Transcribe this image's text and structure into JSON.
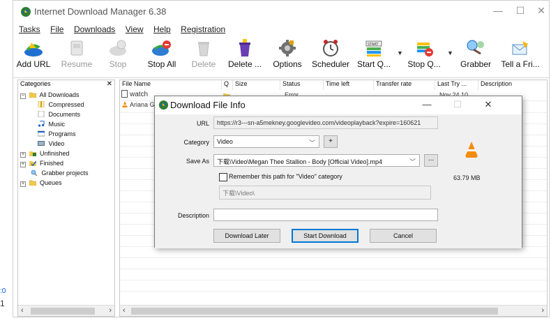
{
  "app": {
    "title": "Internet Download Manager 6.38",
    "window_controls": {
      "minimize": "—",
      "maximize": "☐",
      "close": "✕"
    }
  },
  "menu": {
    "items": [
      "Tasks",
      "File",
      "Downloads",
      "View",
      "Help",
      "Registration"
    ]
  },
  "toolbar": {
    "buttons": [
      {
        "label": "Add URL",
        "icon": "add-url-icon",
        "enabled": true
      },
      {
        "label": "Resume",
        "icon": "resume-icon",
        "enabled": false
      },
      {
        "label": "Stop",
        "icon": "stop-icon",
        "enabled": false
      },
      {
        "label": "Stop All",
        "icon": "stop-all-icon",
        "enabled": true
      },
      {
        "label": "Delete",
        "icon": "delete-icon",
        "enabled": false
      },
      {
        "label": "Delete ...",
        "icon": "delete-completed-icon",
        "enabled": true
      },
      {
        "label": "Options",
        "icon": "options-icon",
        "enabled": true
      },
      {
        "label": "Scheduler",
        "icon": "scheduler-icon",
        "enabled": true
      },
      {
        "label": "Start Q...",
        "icon": "start-queue-icon",
        "enabled": true
      },
      {
        "label": "Stop Q...",
        "icon": "stop-queue-icon",
        "enabled": true
      },
      {
        "label": "Grabber",
        "icon": "grabber-icon",
        "enabled": true
      },
      {
        "label": "Tell a Fri...",
        "icon": "tell-a-friend-icon",
        "enabled": true
      }
    ]
  },
  "categories": {
    "header": "Categories",
    "close": "✕",
    "tree": [
      {
        "label": "All Downloads",
        "level": 0,
        "expander": "⊟",
        "icon": "folder-icon"
      },
      {
        "label": "Compressed",
        "level": 1,
        "icon": "compressed-icon"
      },
      {
        "label": "Documents",
        "level": 1,
        "icon": "documents-icon"
      },
      {
        "label": "Music",
        "level": 1,
        "icon": "music-icon"
      },
      {
        "label": "Programs",
        "level": 1,
        "icon": "programs-icon"
      },
      {
        "label": "Video",
        "level": 1,
        "icon": "video-icon"
      },
      {
        "label": "Unfinished",
        "level": 0,
        "expander": "⊞",
        "icon": "unfinished-icon"
      },
      {
        "label": "Finished",
        "level": 0,
        "expander": "⊞",
        "icon": "finished-icon"
      },
      {
        "label": "Grabber projects",
        "level": 1,
        "icon": "grabber-projects-icon"
      },
      {
        "label": "Queues",
        "level": 0,
        "expander": "⊞",
        "icon": "queues-icon"
      }
    ]
  },
  "file_list": {
    "columns": [
      "File Name",
      "Q",
      "Size",
      "Status",
      "Time left",
      "Transfer rate",
      "Last Try ...",
      "Description"
    ],
    "rows": [
      {
        "name": "watch",
        "status": "Error",
        "last_try": "Nov 24 10..."
      },
      {
        "name": "Ariana Gra"
      }
    ]
  },
  "dialog": {
    "title": "Download File Info",
    "controls": {
      "minimize": "—",
      "maximize": "☐",
      "close": "✕"
    },
    "url_label": "URL",
    "url_value": "https://r3---sn-a5mekney.googlevideo.com/videoplayback?expire=160621",
    "category_label": "Category",
    "category_value": "Video",
    "category_add": "+",
    "save_as_label": "Save As",
    "save_as_value": "下载\\Video\\Megan Thee Stallion - Body [Official Video].mp4",
    "browse_label": "...",
    "remember_label": "Remember this path for \"Video\" category",
    "remember_path": "下载\\Video\\",
    "description_label": "Description",
    "description_value": "",
    "file_size": "63.79  MB",
    "buttons": {
      "download_later": "Download Later",
      "start_download": "Start Download",
      "cancel": "Cancel"
    }
  },
  "colors": {
    "accent": "#0078d7",
    "vlc_orange": "#f28c0f"
  }
}
